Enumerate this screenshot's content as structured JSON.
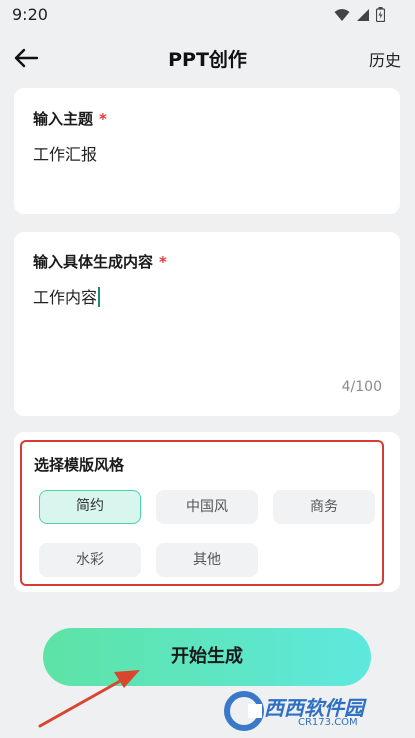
{
  "status": {
    "time": "9:20"
  },
  "header": {
    "title": "PPT创作",
    "history_label": "历史"
  },
  "theme": {
    "label": "输入主题",
    "required_mark": "*",
    "value": "工作汇报"
  },
  "content": {
    "label": "输入具体生成内容",
    "required_mark": "*",
    "value": "工作内容",
    "counter": "4/100"
  },
  "style": {
    "label": "选择模版风格",
    "options": [
      "简约",
      "中国风",
      "商务",
      "水彩",
      "其他"
    ],
    "selected": "简约"
  },
  "actions": {
    "start_label": "开始生成"
  },
  "watermark": {
    "text": "西西软件园",
    "subtext": "CR173.COM"
  },
  "colors": {
    "accent_red": "#d43c34",
    "button_gradient_start": "#5de3a5",
    "button_gradient_end": "#5ee8de",
    "selected_chip_bg": "#d8f5ee"
  }
}
